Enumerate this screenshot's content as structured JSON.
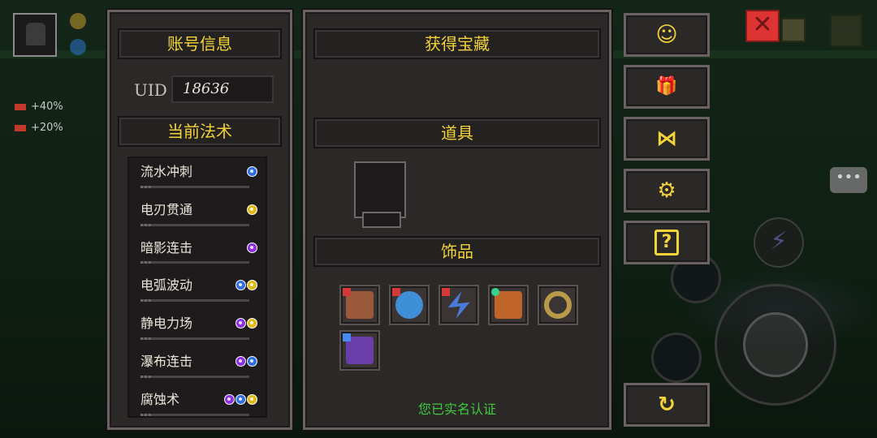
{
  "hud": {
    "stats": [
      {
        "label": "+40%"
      },
      {
        "label": "+20%"
      }
    ]
  },
  "account_panel": {
    "title": "账号信息",
    "uid_label": "UID",
    "uid_value": "18636",
    "spells_title": "当前法术",
    "spells": [
      {
        "name": "流水冲刺",
        "elements": [
          "water"
        ]
      },
      {
        "name": "电刃贯通",
        "elements": [
          "lightning"
        ]
      },
      {
        "name": "暗影连击",
        "elements": [
          "shadow"
        ]
      },
      {
        "name": "电弧波动",
        "elements": [
          "water",
          "lightning"
        ]
      },
      {
        "name": "静电力场",
        "elements": [
          "shadow",
          "lightning"
        ]
      },
      {
        "name": "瀑布连击",
        "elements": [
          "shadow",
          "water"
        ]
      },
      {
        "name": "腐蚀术",
        "elements": [
          "shadow",
          "water",
          "lightning"
        ]
      }
    ]
  },
  "treasure_panel": {
    "title": "获得宝藏",
    "items_title": "道具",
    "accessories_title": "饰品",
    "accessories": [
      {
        "icon": "wooden-chest-icon",
        "color": "#9a5a3a",
        "tag": "#d23a3a"
      },
      {
        "icon": "blue-egg-icon",
        "color": "#3e8fd6",
        "tag": "#d23a3a"
      },
      {
        "icon": "lightning-boots-icon",
        "color": "#4a7ad8",
        "tag": "#d23a3a"
      },
      {
        "icon": "bull-head-icon",
        "color": "#c0652a",
        "tag": "#34d48a"
      },
      {
        "icon": "golden-ring-icon",
        "color": "#b89a4a",
        "tag": ""
      },
      {
        "icon": "purple-cloak-icon",
        "color": "#6a3ea8",
        "tag": "#4a8af0"
      }
    ],
    "verified_text": "您已实名认证"
  },
  "side_buttons": [
    {
      "icon": "support-headset-icon",
      "glyph": "☺"
    },
    {
      "icon": "gift-icon",
      "glyph": "🎁"
    },
    {
      "icon": "bowtie-icon",
      "glyph": "⋈"
    },
    {
      "icon": "settings-icon",
      "glyph": "⚙"
    },
    {
      "icon": "help-book-icon",
      "glyph": "?"
    },
    {
      "icon": "refresh-icon",
      "glyph": "↻"
    }
  ],
  "colors": {
    "title_yellow": "#f3d33a",
    "verified_green": "#3fc93c",
    "panel_bg": "#2b2828"
  }
}
